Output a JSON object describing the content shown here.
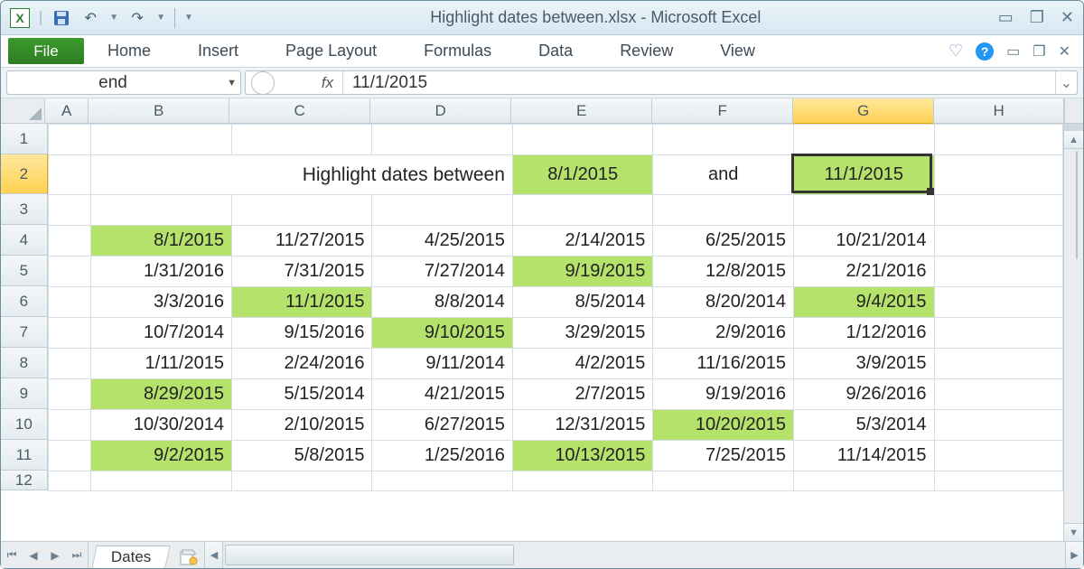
{
  "window": {
    "title": "Highlight dates between.xlsx - Microsoft Excel",
    "excel_glyph": "X"
  },
  "qat": {
    "save": "💾",
    "undo": "↶",
    "redo": "↷"
  },
  "win_controls": {
    "min": "▭",
    "max": "❐",
    "close": "✕"
  },
  "ribbon": {
    "file": "File",
    "tabs": [
      "Home",
      "Insert",
      "Page Layout",
      "Formulas",
      "Data",
      "Review",
      "View"
    ],
    "heart": "♡",
    "help": "?"
  },
  "doc_controls": {
    "min": "▭",
    "restore": "❐",
    "close": "✕"
  },
  "formula": {
    "name_box": "end",
    "fx_label": "fx",
    "value": "11/1/2015"
  },
  "columns": [
    "A",
    "B",
    "C",
    "D",
    "E",
    "F",
    "G",
    "H"
  ],
  "selected_col": "G",
  "selected_row": 2,
  "header": {
    "label": "Highlight dates between",
    "start": "8/1/2015",
    "and": "and",
    "end": "11/1/2015"
  },
  "active_cell": {
    "col": "G",
    "row": 2
  },
  "highlight_color": "#b5e26a",
  "data_rows": [
    {
      "r": 4,
      "cells": [
        {
          "v": "8/1/2015",
          "h": true
        },
        {
          "v": "11/27/2015"
        },
        {
          "v": "4/25/2015"
        },
        {
          "v": "2/14/2015"
        },
        {
          "v": "6/25/2015"
        },
        {
          "v": "10/21/2014"
        }
      ]
    },
    {
      "r": 5,
      "cells": [
        {
          "v": "1/31/2016"
        },
        {
          "v": "7/31/2015"
        },
        {
          "v": "7/27/2014"
        },
        {
          "v": "9/19/2015",
          "h": true
        },
        {
          "v": "12/8/2015"
        },
        {
          "v": "2/21/2016"
        }
      ]
    },
    {
      "r": 6,
      "cells": [
        {
          "v": "3/3/2016"
        },
        {
          "v": "11/1/2015",
          "h": true
        },
        {
          "v": "8/8/2014"
        },
        {
          "v": "8/5/2014"
        },
        {
          "v": "8/20/2014"
        },
        {
          "v": "9/4/2015",
          "h": true
        }
      ]
    },
    {
      "r": 7,
      "cells": [
        {
          "v": "10/7/2014"
        },
        {
          "v": "9/15/2016"
        },
        {
          "v": "9/10/2015",
          "h": true
        },
        {
          "v": "3/29/2015"
        },
        {
          "v": "2/9/2016"
        },
        {
          "v": "1/12/2016"
        }
      ]
    },
    {
      "r": 8,
      "cells": [
        {
          "v": "1/11/2015"
        },
        {
          "v": "2/24/2016"
        },
        {
          "v": "9/11/2014"
        },
        {
          "v": "4/2/2015"
        },
        {
          "v": "11/16/2015"
        },
        {
          "v": "3/9/2015"
        }
      ]
    },
    {
      "r": 9,
      "cells": [
        {
          "v": "8/29/2015",
          "h": true
        },
        {
          "v": "5/15/2014"
        },
        {
          "v": "4/21/2015"
        },
        {
          "v": "2/7/2015"
        },
        {
          "v": "9/19/2016"
        },
        {
          "v": "9/26/2016"
        }
      ]
    },
    {
      "r": 10,
      "cells": [
        {
          "v": "10/30/2014"
        },
        {
          "v": "2/10/2015"
        },
        {
          "v": "6/27/2015"
        },
        {
          "v": "12/31/2015"
        },
        {
          "v": "10/20/2015",
          "h": true
        },
        {
          "v": "5/3/2014"
        }
      ]
    },
    {
      "r": 11,
      "cells": [
        {
          "v": "9/2/2015",
          "h": true
        },
        {
          "v": "5/8/2015"
        },
        {
          "v": "1/25/2016"
        },
        {
          "v": "10/13/2015",
          "h": true
        },
        {
          "v": "7/25/2015"
        },
        {
          "v": "11/14/2015"
        }
      ]
    }
  ],
  "sheet": {
    "active": "Dates"
  }
}
